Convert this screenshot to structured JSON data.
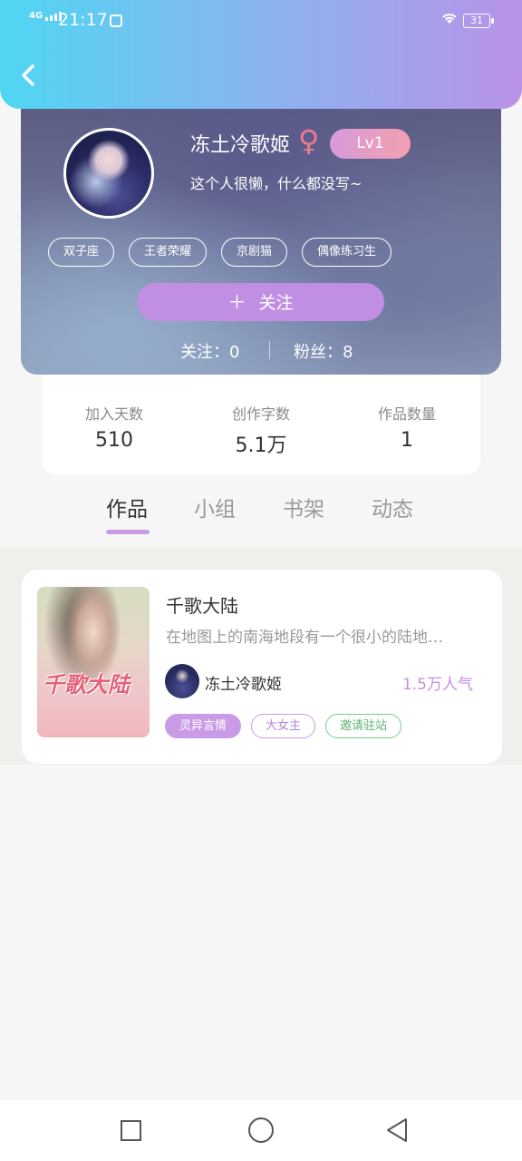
{
  "status_bar": {
    "network": "4G",
    "time": "21:17",
    "battery": "31"
  },
  "profile": {
    "name": "冻土冷歌姬",
    "gender_symbol": "♀",
    "level": "Lv1",
    "bio": "这个人很懒，什么都没写~",
    "tags": [
      "双子座",
      "王者荣耀",
      "京剧猫",
      "偶像练习生"
    ],
    "follow_button": "关注",
    "following_label": "关注：0",
    "fans_label": "粉丝：8"
  },
  "stats": [
    {
      "label": "加入天数",
      "value": "510"
    },
    {
      "label": "创作字数",
      "value": "5.1万"
    },
    {
      "label": "作品数量",
      "value": "1"
    }
  ],
  "tabs": [
    "作品",
    "小组",
    "书架",
    "动态"
  ],
  "active_tab": "作品",
  "work": {
    "cover_text": "千歌大陆",
    "title": "千歌大陆",
    "description": "在地图上的南海地段有一个很小的陆地…",
    "author": "冻土冷歌姬",
    "popularity": "1.5万人气",
    "tags": [
      "灵异言情",
      "大女主",
      "邀请驻站"
    ]
  },
  "colors": {
    "accent": "#c99be6",
    "header_gradient_start": "#4fd6f3",
    "header_gradient_end": "#b992e8",
    "level_badge": "#f3a0b0",
    "invite_tag": "#7cc98f"
  }
}
